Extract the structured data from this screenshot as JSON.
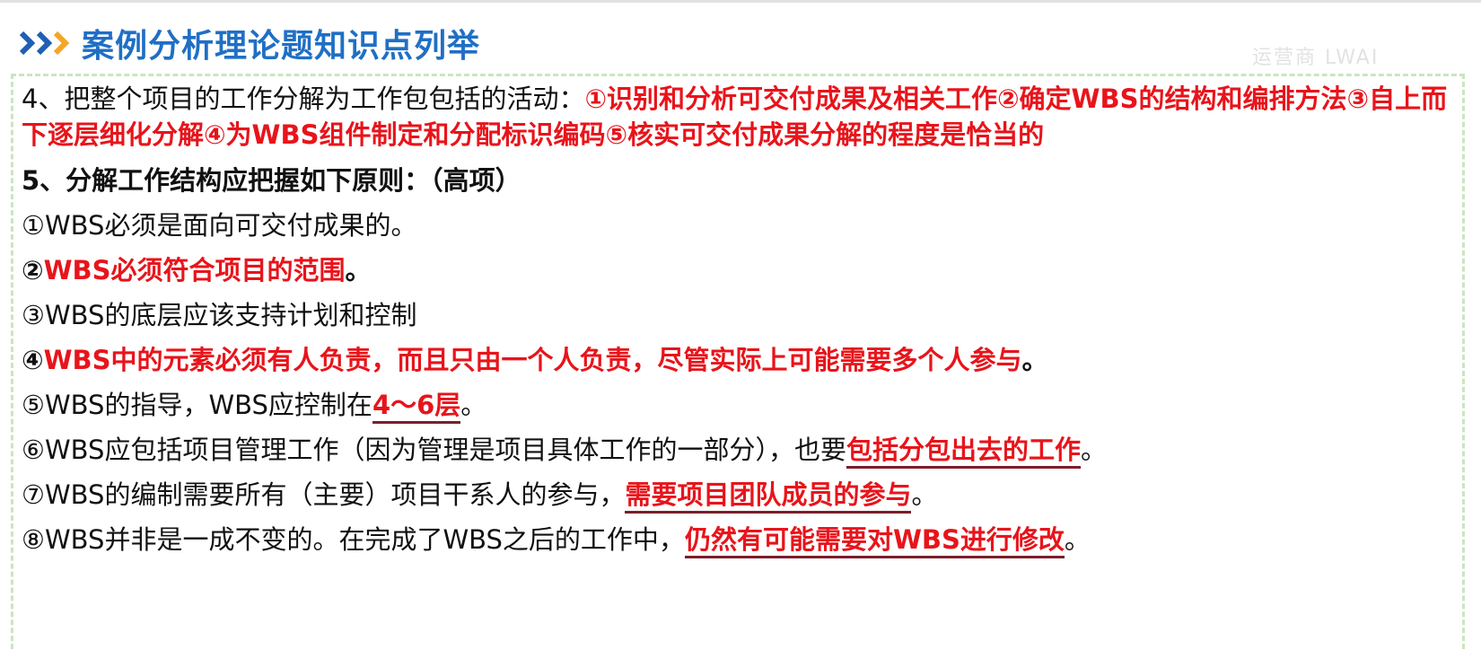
{
  "header": {
    "title": "案例分析理论题知识点列举",
    "watermark": "运营商 LWAI"
  },
  "colors": {
    "title_blue": "#1f6fc5",
    "chevron_blue": "#1f5fb5",
    "chevron_orange": "#f5a623",
    "highlight_red": "#e8141b",
    "frame_green": "#c9e6bf"
  },
  "item4": {
    "prefix": "4、把整个项目的工作分解为工作包包括的活动：",
    "highlight": "①识别和分析可交付成果及相关工作②确定WBS的结构和编排方法③自上而下逐层细化分解④为WBS组件制定和分配标识编码⑤核实可交付成果分解的程度是恰当的"
  },
  "item5": {
    "heading": "5、分解工作结构应把握如下原则：（高项）",
    "p1": "①WBS必须是面向可交付成果的。",
    "p2_num": "②",
    "p2_text": "WBS必须符合项目的范围",
    "p2_end": "。",
    "p3": "③WBS的底层应该支持计划和控制",
    "p4_num": "④",
    "p4_text": "WBS中的元素必须有人负责，而且只由一个人负责，尽管实际上可能需要多个人参与",
    "p4_end": "。",
    "p5_text": "⑤WBS的指导，WBS应控制在",
    "p5_highlight": "4～6层",
    "p5_end": "。",
    "p6_text": "⑥WBS应包括项目管理工作（因为管理是项目具体工作的一部分），也要",
    "p6_highlight": "包括分包出去的工作",
    "p6_end": "。",
    "p7_text": "⑦WBS的编制需要所有（主要）项目干系人的参与，",
    "p7_highlight": "需要项目团队成员的参与",
    "p7_end": "。",
    "p8_text": "⑧WBS并非是一成不变的。在完成了WBS之后的工作中，",
    "p8_highlight": "仍然有可能需要对WBS进行修改",
    "p8_end": "。"
  }
}
